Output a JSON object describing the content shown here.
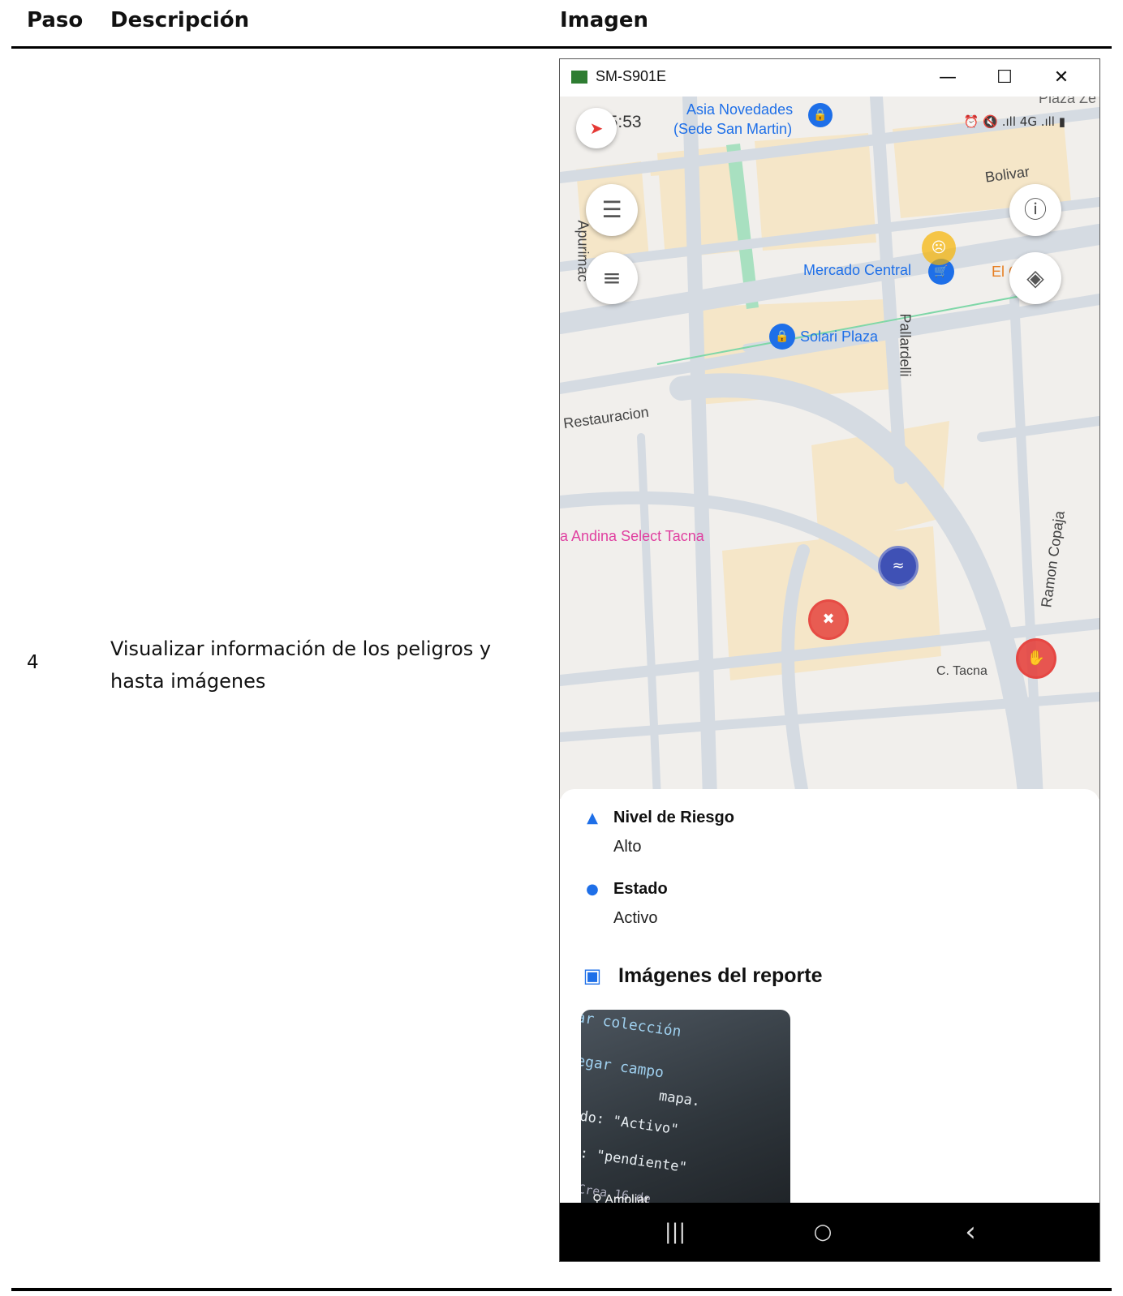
{
  "table": {
    "headers": [
      "Paso",
      "Descripción",
      "Imagen"
    ],
    "rows": [
      {
        "paso": "4",
        "descripcion": "Visualizar información de los peligros y hasta imágenes"
      }
    ]
  },
  "window": {
    "title": "SM-S901E",
    "controls": {
      "minimize": "—",
      "maximize": "☐",
      "close": "✕"
    }
  },
  "phone": {
    "status_time": "15:53",
    "status_icons": "⏰ 🔇 .ıll 4G .ıll ▮",
    "map_labels": {
      "asia": "Asia Novedades",
      "sede": "(Sede San Martin)",
      "bolivar": "Bolivar",
      "apurimac": "Apurimac",
      "mercado": "Mercado Central",
      "el_cesto": "El C... no",
      "pallardelli": "Pallardelli",
      "solari": "Solari Plaza",
      "restauracion": "Restauracion",
      "andina": "a Andina Select Tacna",
      "ramon": "Ramon Copaja",
      "ctacna": "C. Tacna",
      "plaza_top": "Plaza Ze"
    },
    "map_buttons": {
      "menu": "☰",
      "filter": "≡",
      "info": "ⓘ",
      "layers": "◈"
    },
    "sheet": {
      "nivel_label": "Nivel de Riesgo",
      "nivel_value": "Alto",
      "estado_label": "Estado",
      "estado_value": "Activo",
      "imagenes_title": "Imágenes del reporte",
      "ampliar_label": "Ampliar",
      "thumb_text": [
        "ar colección",
        "egar campo",
        "mapa.",
        "do: \"Activo\"",
        ": \"pendiente\"",
        "Crea 16 de"
      ]
    },
    "navbar": {
      "recents": "|||",
      "home": "○",
      "back": "‹"
    }
  },
  "colors": {
    "accent_blue": "#1e6fe8",
    "danger_red": "#e53935",
    "warning_yellow": "#f6b400",
    "map_block": "#f5e6c8",
    "road": "#d5dbe2"
  }
}
